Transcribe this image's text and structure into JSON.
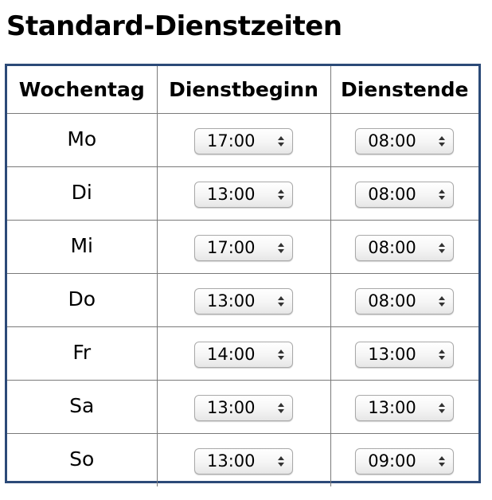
{
  "page": {
    "title": "Standard-Dienstzeiten"
  },
  "table": {
    "headers": {
      "day": "Wochentag",
      "start": "Dienstbeginn",
      "end": "Dienstende"
    },
    "rows": [
      {
        "day": "Mo",
        "start": "17:00",
        "end": "08:00"
      },
      {
        "day": "Di",
        "start": "13:00",
        "end": "08:00"
      },
      {
        "day": "Mi",
        "start": "17:00",
        "end": "08:00"
      },
      {
        "day": "Do",
        "start": "13:00",
        "end": "08:00"
      },
      {
        "day": "Fr",
        "start": "14:00",
        "end": "13:00"
      },
      {
        "day": "Sa",
        "start": "13:00",
        "end": "13:00"
      },
      {
        "day": "So",
        "start": "13:00",
        "end": "09:00"
      }
    ]
  },
  "icons": {
    "select_arrow": "updown-arrows-icon"
  },
  "colors": {
    "table_border": "#2c4a78",
    "cell_border": "#7a7a7a"
  }
}
